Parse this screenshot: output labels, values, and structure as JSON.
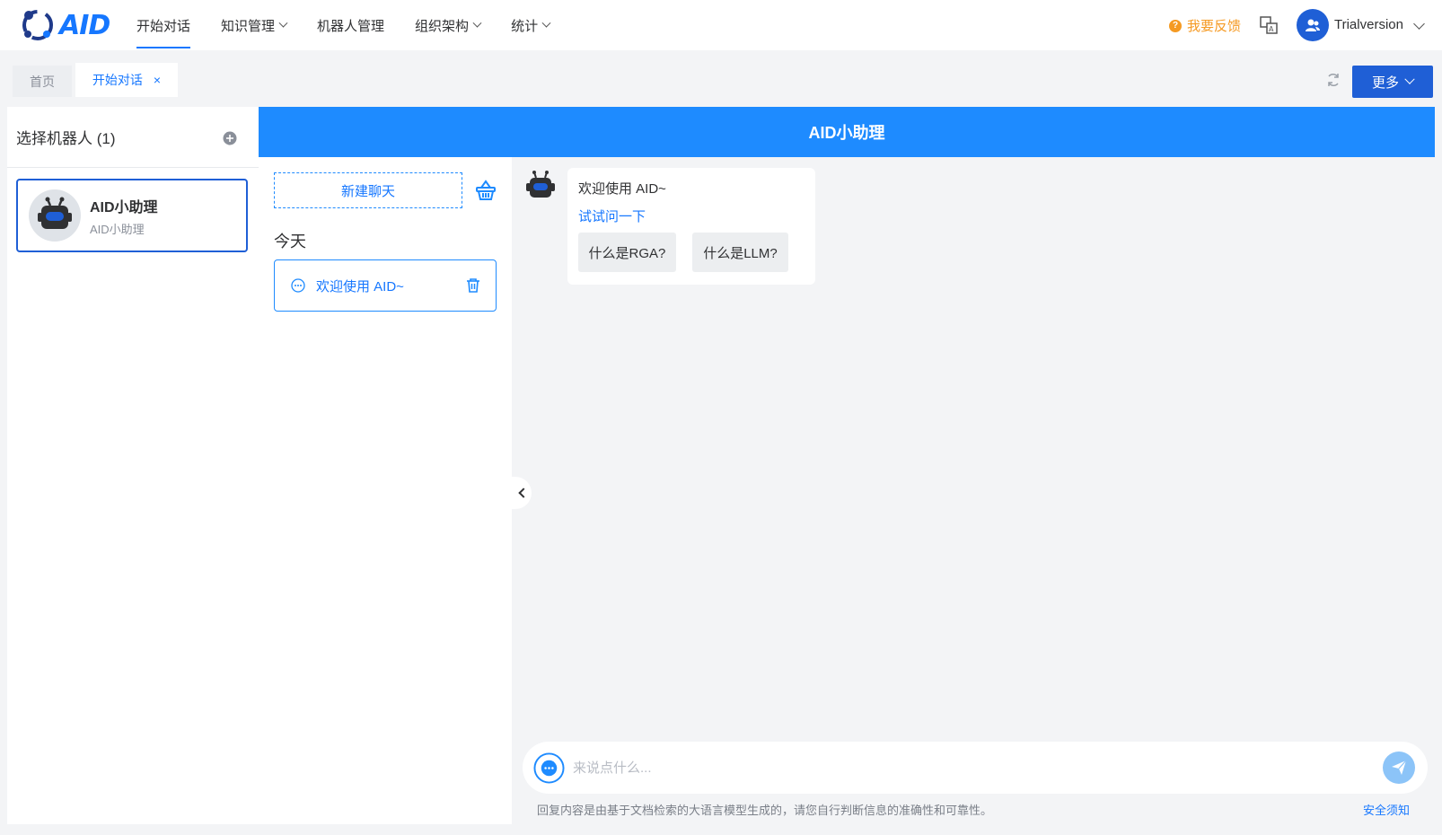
{
  "brand": {
    "logo_text": "AID",
    "accent": "#1677ff",
    "header_blue": "#1e8bff",
    "dark_blue": "#1f5fd6"
  },
  "nav": {
    "items": [
      {
        "label": "开始对话",
        "has_dropdown": false,
        "active": true
      },
      {
        "label": "知识管理",
        "has_dropdown": true
      },
      {
        "label": "机器人管理",
        "has_dropdown": false
      },
      {
        "label": "组织架构",
        "has_dropdown": true
      },
      {
        "label": "统计",
        "has_dropdown": true
      }
    ],
    "feedback_label": "我要反馈",
    "username": "Trialversion"
  },
  "tabs": {
    "items": [
      {
        "label": "首页"
      },
      {
        "label": "开始对话",
        "closable": true
      }
    ],
    "close_glyph": "×",
    "more_label": "更多"
  },
  "robots": {
    "title": "选择机器人 (1)",
    "items": [
      {
        "name": "AID小助理",
        "subtitle": "AID小助理"
      }
    ]
  },
  "chat": {
    "title": "AID小助理",
    "new_chat_label": "新建聊天",
    "group_label": "今天",
    "sessions": [
      {
        "title": "欢迎使用 AID~"
      }
    ],
    "messages": [
      {
        "text": "欢迎使用 AID~",
        "try_label": "试试问一下",
        "suggestions": [
          "什么是RGA?",
          "什么是LLM?"
        ]
      }
    ],
    "input_placeholder": "来说点什么...",
    "disclaimer": "回复内容是由基于文档检索的大语言模型生成的，请您自行判断信息的准确性和可靠性。",
    "safety_link": "安全须知"
  }
}
